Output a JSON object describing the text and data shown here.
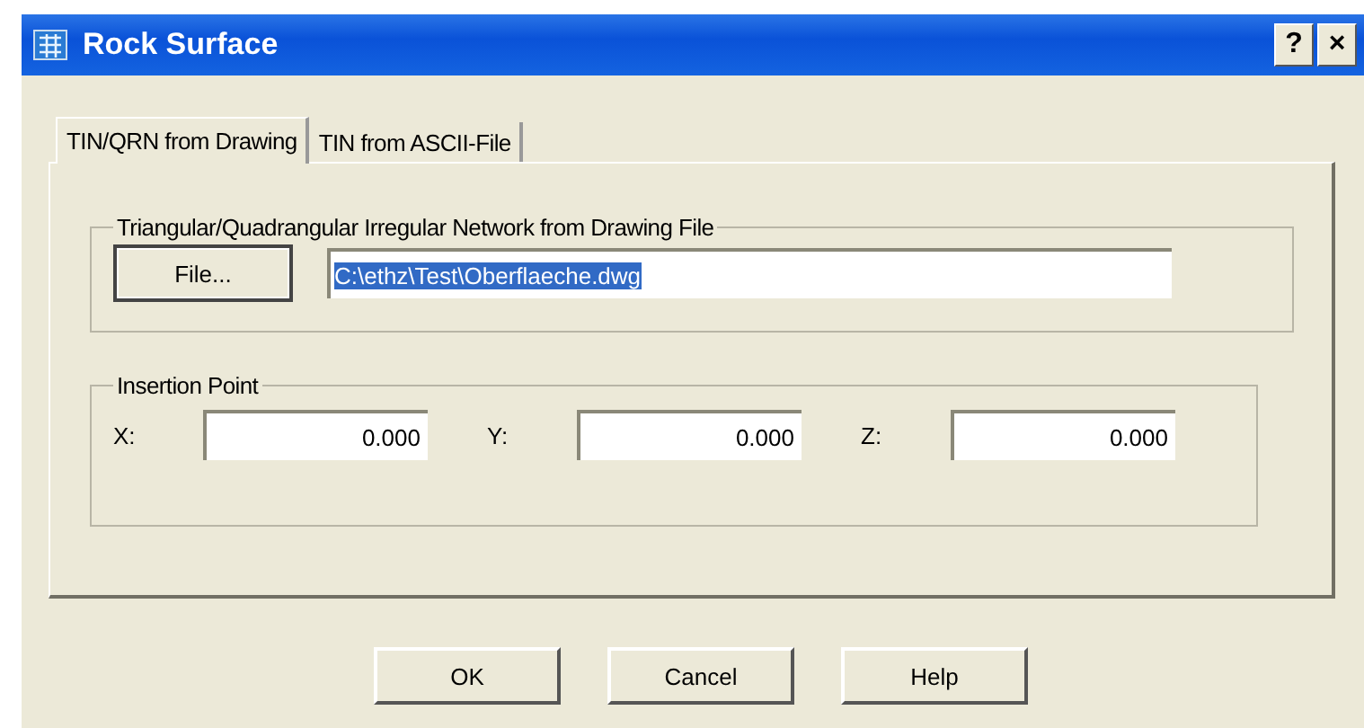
{
  "window": {
    "title": "Rock Surface",
    "title_buttons": [
      "?",
      "×"
    ]
  },
  "tabs": [
    {
      "label": "TIN/QRN from Drawing",
      "selected": true
    },
    {
      "label": "TIN from ASCII-File",
      "selected": false
    }
  ],
  "drawing_group": {
    "title": "Triangular/Quadrangular Irregular Network from Drawing File",
    "button": "File...",
    "path": {
      "value": "C:\\ethz\\Test\\Oberflaeche.dwg",
      "text_selected": true
    }
  },
  "insertion_group": {
    "title": "Insertion Point",
    "fields": [
      {
        "label": "X:",
        "value": "0.000"
      },
      {
        "label": "Y:",
        "value": "0.000"
      },
      {
        "label": "Z:",
        "value": "0.000"
      }
    ]
  },
  "buttons": [
    "OK",
    "Cancel",
    "Help"
  ]
}
